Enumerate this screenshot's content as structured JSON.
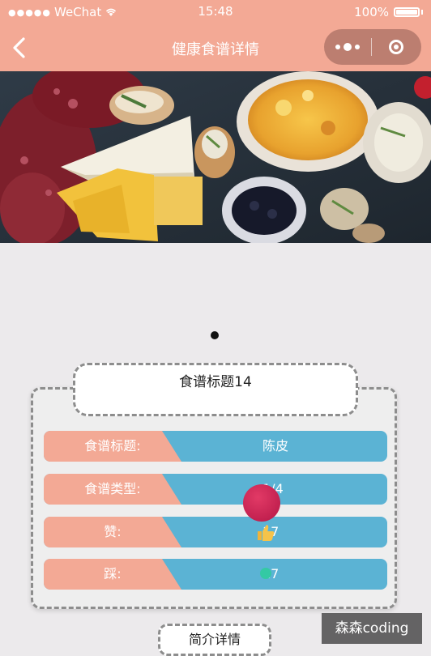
{
  "status_bar": {
    "carrier": "WeChat",
    "time": "15:48",
    "battery": "100%"
  },
  "nav": {
    "title": "健康食谱详情",
    "back_icon": "chevron-left-icon",
    "more_icon": "more-dots-icon",
    "close_icon": "target-icon"
  },
  "banner": {
    "icon": "food-photo"
  },
  "recipe": {
    "title": "食谱标题14",
    "rows": [
      {
        "key": "食谱标题:",
        "value": "陈皮"
      },
      {
        "key": "食谱类型:",
        "value": "1/4"
      },
      {
        "key": "赞:",
        "value": "17"
      },
      {
        "key": "踩:",
        "value": "17"
      }
    ]
  },
  "tabs": {
    "intro": "简介详情"
  },
  "watermark": "森森coding",
  "colors": {
    "theme": "#f3a995",
    "key_bg": "#f3a995",
    "value_bg": "#5bb3d4"
  }
}
